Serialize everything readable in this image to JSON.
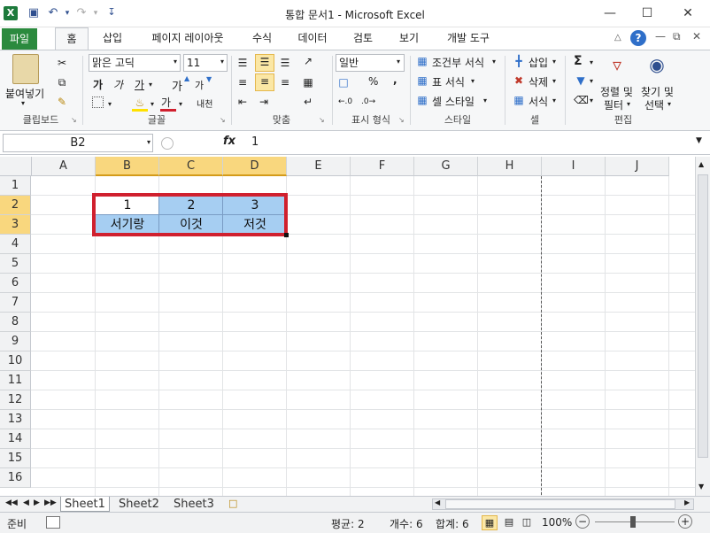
{
  "window": {
    "title": "통합 문서1  -  Microsoft Excel",
    "minimize_icon": "minimize-icon",
    "maximize_icon": "maximize-icon",
    "close_icon": "close-icon"
  },
  "tabs": [
    "파일",
    "홈",
    "삽입",
    "페이지 레이아웃",
    "수식",
    "데이터",
    "검토",
    "보기",
    "개발 도구"
  ],
  "ribbon": {
    "clipboard": {
      "paste": "붙여넣기",
      "label": "클립보드"
    },
    "font": {
      "name": "맑은 고딕",
      "size": "11",
      "bold": "가",
      "italic": "가",
      "underline": "가",
      "grow": "가",
      "shrink": "가",
      "font_color": "가",
      "phonetic": "내천",
      "label": "글꼴"
    },
    "alignment": {
      "label": "맞춤"
    },
    "number": {
      "format": "일반",
      "percent": "%",
      "comma": ",",
      "label": "표시 형식"
    },
    "styles": {
      "conditional": "조건부 서식",
      "table": "표 서식",
      "cell": "셀 스타일",
      "label": "스타일"
    },
    "cells": {
      "insert": "삽입",
      "delete": "삭제",
      "format": "서식",
      "label": "셀"
    },
    "editing": {
      "sum": "Σ",
      "sort_line1": "정렬 및",
      "sort_line2": "필터",
      "find_line1": "찾기 및",
      "find_line2": "선택",
      "label": "편집"
    }
  },
  "formula_bar": {
    "name_box": "B2",
    "fx": "fx",
    "value": "1"
  },
  "columns": [
    "A",
    "B",
    "C",
    "D",
    "E",
    "F",
    "G",
    "H",
    "I",
    "J"
  ],
  "rows": [
    "1",
    "2",
    "3",
    "4",
    "5",
    "6",
    "7",
    "8",
    "9",
    "10",
    "11",
    "12",
    "13",
    "14",
    "15",
    "16"
  ],
  "cells": {
    "B2": "1",
    "C2": "2",
    "D2": "3",
    "B3": "서기랑",
    "C3": "이것",
    "D3": "저것"
  },
  "sheets": [
    "Sheet1",
    "Sheet2",
    "Sheet3"
  ],
  "status": {
    "ready": "준비",
    "average": "평균: 2",
    "count": "개수: 6",
    "sum": "합계: 6",
    "zoom": "100%"
  },
  "colors": {
    "selection_fill": "#a6cef2",
    "annotation_border": "#d0202e",
    "file_tab": "#2b8a3e"
  }
}
